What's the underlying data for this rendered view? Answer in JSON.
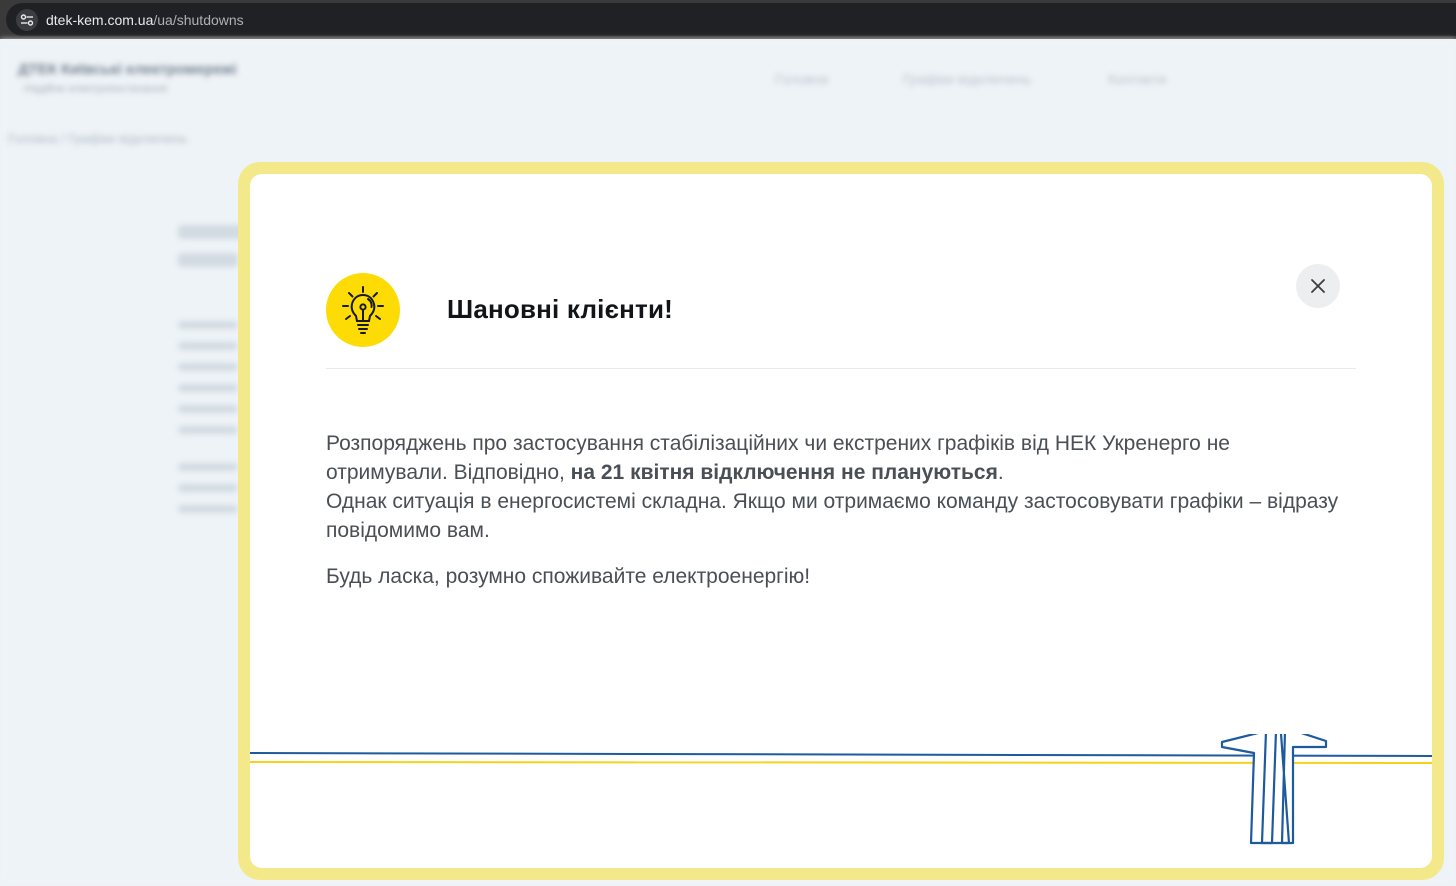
{
  "browser": {
    "url_host": "dtek-kem.com.ua",
    "url_path": "/ua/shutdowns"
  },
  "background": {
    "logo_title": "ДТЕК Київські електромережі",
    "logo_subtitle": "Надійне електропостачання",
    "nav": [
      "Головна",
      "Графіки відключень",
      "Контакти"
    ],
    "breadcrumb": "Головна / Графіки відключень"
  },
  "modal": {
    "title": "Шановні клієнти!",
    "paragraph_1_part_1": "Розпоряджень про застосування стабілізаційних чи екстрених графіків від НЕК Укренерго не отримували. Відповідно, ",
    "paragraph_1_bold": "на 21 квітня відключення не плануються",
    "paragraph_1_part_2": ".",
    "paragraph_2": "Однак ситуація в енергосистемі складна. Якщо ми отримаємо команду застосовувати графіки – відразу повідомимо вам.",
    "closing": "Будь ласка, розумно споживайте електроенергію!",
    "icons": {
      "bulb": "lightbulb-icon",
      "close": "close-icon",
      "tower": "power-tower-illustration"
    },
    "colors": {
      "frame": "#f4e98a",
      "bulb_bg": "#fcdc04",
      "line_blue": "#1d5a9e",
      "line_yellow": "#f3d31c"
    }
  }
}
